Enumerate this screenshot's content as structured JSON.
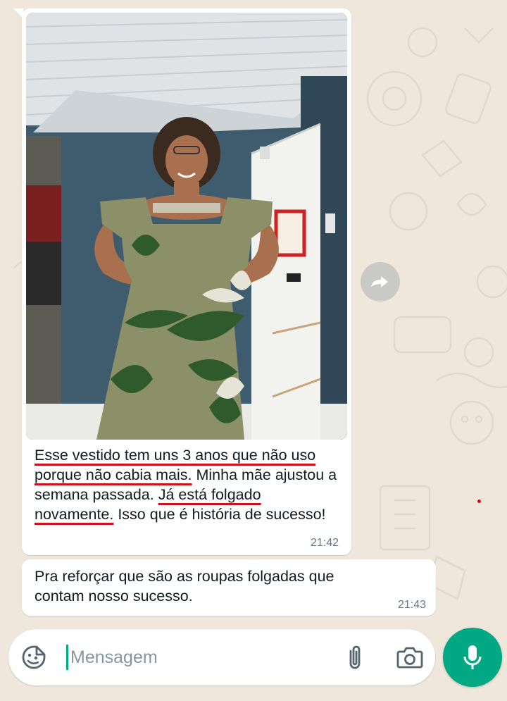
{
  "chat": {
    "messages": [
      {
        "type": "image",
        "caption": {
          "s1": "Esse vestido tem uns 3 anos que não uso porque não cabia mais.",
          "s2": " Minha mãe ajustou a semana passada. ",
          "s3": "Já está folgado novamente.",
          "s4": " Isso que é história de sucesso!"
        },
        "time": "21:42"
      },
      {
        "type": "text",
        "text": "Pra reforçar que são as roupas folgadas que contam nosso sucesso.",
        "time": "21:43"
      }
    ]
  },
  "composer": {
    "placeholder": "Mensagem",
    "value": ""
  },
  "icons": {
    "forward": "forward-icon",
    "sticker": "sticker-icon",
    "attach": "paperclip-icon",
    "camera": "camera-icon",
    "mic": "mic-icon"
  },
  "colors": {
    "accent": "#00a884",
    "underline": "#d0101d",
    "bubble": "#ffffff",
    "wallpaper": "#efe7dc"
  }
}
